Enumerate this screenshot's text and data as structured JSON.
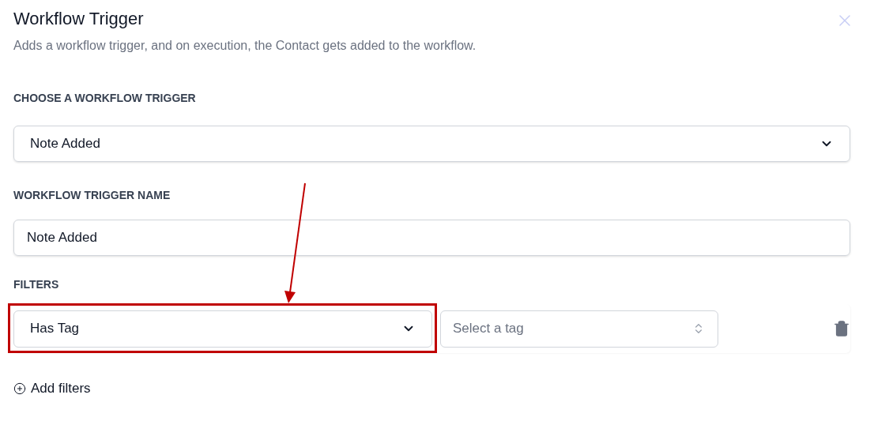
{
  "title": "Workflow Trigger",
  "subtitle": "Adds a workflow trigger, and on execution, the Contact gets added to the workflow.",
  "trigger_section": {
    "label": "CHOOSE A WORKFLOW TRIGGER",
    "value": "Note Added"
  },
  "name_section": {
    "label": "WORKFLOW TRIGGER NAME",
    "value": "Note Added"
  },
  "filters": {
    "label": "FILTERS",
    "rows": [
      {
        "condition": "Has Tag",
        "tag_placeholder": "Select a tag",
        "highlighted": true
      }
    ]
  },
  "add_filters": "Add filters"
}
